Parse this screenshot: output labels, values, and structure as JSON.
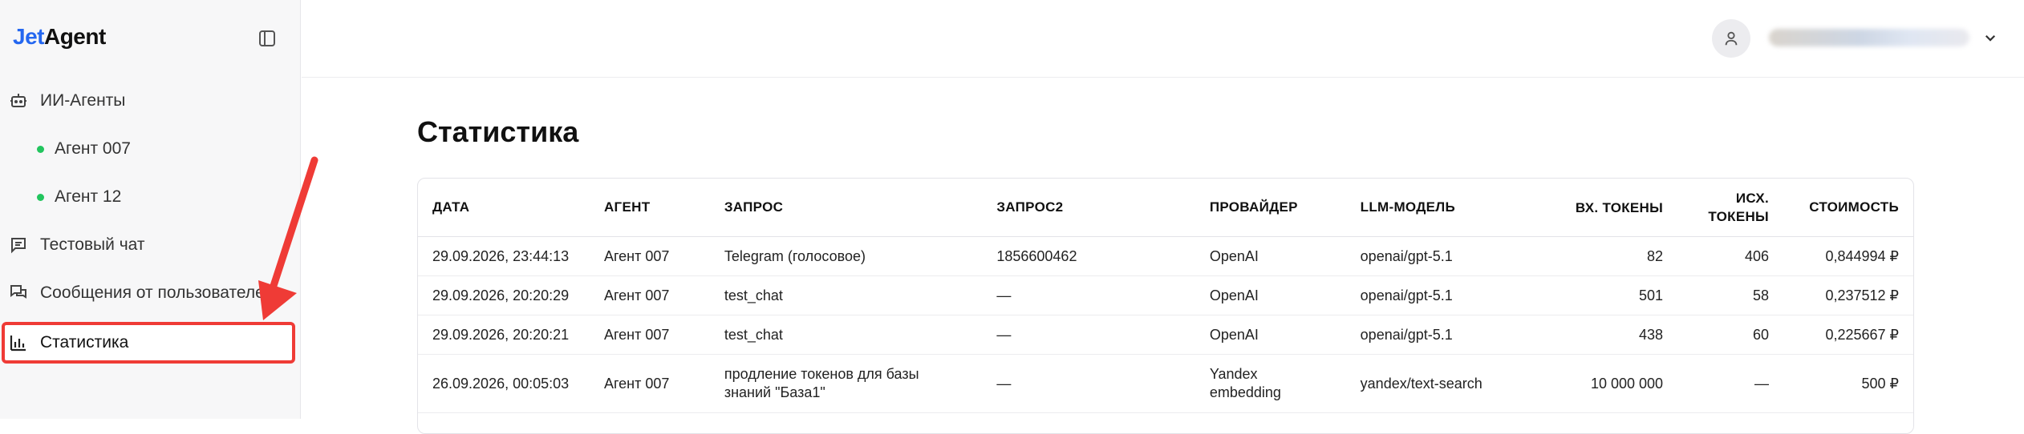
{
  "logo": {
    "part1": "Jet",
    "part2": "Agent"
  },
  "sidebar": {
    "items": [
      {
        "label": "ИИ-Агенты"
      },
      {
        "label": "Агент 007"
      },
      {
        "label": "Агент 12"
      },
      {
        "label": "Тестовый чат"
      },
      {
        "label": "Сообщения от пользователей"
      },
      {
        "label": "Статистика"
      }
    ]
  },
  "main": {
    "title": "Статистика",
    "columns": [
      "ДАТА",
      "АГЕНТ",
      "ЗАПРОС",
      "ЗАПРОС2",
      "ПРОВАЙДЕР",
      "LLM-МОДЕЛЬ",
      "ВХ. ТОКЕНЫ",
      "ИСХ. ТОКЕНЫ",
      "СТОИМОСТЬ"
    ],
    "rows": [
      [
        "29.09.2026, 23:44:13",
        "Агент 007",
        "Telegram (голосовое)",
        "1856600462",
        "OpenAI",
        "openai/gpt-5.1",
        "82",
        "406",
        "0,844994 ₽"
      ],
      [
        "29.09.2026, 20:20:29",
        "Агент 007",
        "test_chat",
        "—",
        "OpenAI",
        "openai/gpt-5.1",
        "501",
        "58",
        "0,237512 ₽"
      ],
      [
        "29.09.2026, 20:20:21",
        "Агент 007",
        "test_chat",
        "—",
        "OpenAI",
        "openai/gpt-5.1",
        "438",
        "60",
        "0,225667 ₽"
      ],
      [
        "26.09.2026, 00:05:03",
        "Агент 007",
        "продление токенов для базы знаний \"База1\"",
        "—",
        "Yandex embedding",
        "yandex/text-search",
        "10 000 000",
        "—",
        "500 ₽"
      ]
    ]
  },
  "colors": {
    "accent": "#2467f0",
    "highlight": "#ef3b36",
    "status_dot": "#22c55e"
  },
  "icons": [
    "collapse-sidebar-icon",
    "robot-icon",
    "chat-icon",
    "messages-icon",
    "bar-chart-icon",
    "user-icon",
    "chevron-down-icon"
  ]
}
